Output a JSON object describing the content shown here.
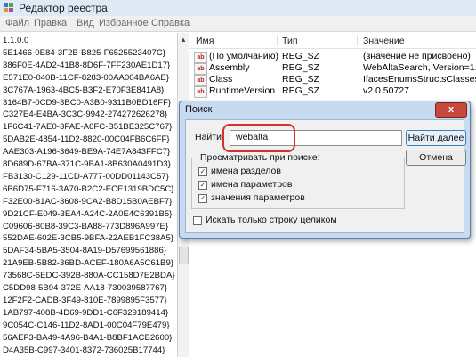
{
  "window": {
    "title": "Редактор реестра",
    "icon": "regedit-icon"
  },
  "menu": [
    "Файл",
    "Правка",
    "Вид",
    "Избранное",
    "Справка"
  ],
  "tree": {
    "rows": [
      "1.1.0.0",
      "5E1466-0E84-3F2B-B825-F6525523407C}",
      "386F0E-4AD2-41B8-8D6F-7FF230AE1D17}",
      "E571E0-040B-11CF-8283-00AA004BA6AE}",
      "3C767A-1963-4BC5-B3F2-E70F3E841A8}",
      "3164B7-0CD9-3BC0-A3B0-9311B0BD16FF}",
      "C327E4-E4BA-3C3C-9942-274272626278}",
      "1F6C41-7AE0-3FAE-A6FC-B51BE325C767}",
      "5DAB2E-4854-11D2-8820-00C04FB6C6FF}",
      "AAE303-A196-3649-BE9A-74E7A843FFC7}",
      "8D689D-67BA-371C-9BA1-8B630A0491D3}",
      "FB3130-C129-11CD-A777-00DD01143C57}",
      "6B6D75-F716-3A70-B2C2-ECE1319BDC5C}",
      "F32E00-81AC-3608-9CA2-B8D15B0AEBF7}",
      "9D21CF-E049-3EA4-A24C-2A0E4C6391B5}",
      "C09606-80B8-39C3-BA88-773D896A997E}",
      "552DAE-602E-3CB5-9BFA-22AEB1FC38A5}",
      "5DAF34-5BA5-3504-8A19-D57699561886}",
      "21A9EB-5B82-36BD-ACEF-180A6A5C61B9}",
      "73568C-6EDC-392B-880A-CC158D7E2BDA}",
      "C5DD98-5B94-372E-AA18-730039587767}",
      "12F2F2-CADB-3F49-810E-7899895F3577}",
      "1AB797-408B-4D69-9DD1-C6F329189414}",
      "9C054C-C146-11D2-8AD1-00C04F79E479}",
      "56AEF3-BA49-4A96-B4A1-B8BF1ACB2600}",
      "D4A35B-C997-3401-8372-736025B17744}"
    ]
  },
  "list": {
    "headers": {
      "name": "Имя",
      "type": "Тип",
      "value": "Значение"
    },
    "rows": [
      {
        "name": "(По умолчанию)",
        "type": "REG_SZ",
        "value": "(значение не присвоено)"
      },
      {
        "name": "Assembly",
        "type": "REG_SZ",
        "value": "WebAltaSearch, Version=1.1.0."
      },
      {
        "name": "Class",
        "type": "REG_SZ",
        "value": "IfacesEnumsStructsClasses.HT"
      },
      {
        "name": "RuntimeVersion",
        "type": "REG_SZ",
        "value": "v2.0.50727"
      }
    ]
  },
  "dialog": {
    "title": "Поиск",
    "close_glyph": "x",
    "find_label": "Найти:",
    "find_value": "webalta",
    "find_next": "Найти далее",
    "cancel": "Отмена",
    "group_label": "Просматривать при поиске:",
    "options": [
      {
        "label": "имена разделов",
        "checked": true
      },
      {
        "label": "имена параметров",
        "checked": true
      },
      {
        "label": "значения параметров",
        "checked": true
      }
    ],
    "whole_string": {
      "label": "Искать только строку целиком",
      "checked": false
    }
  }
}
